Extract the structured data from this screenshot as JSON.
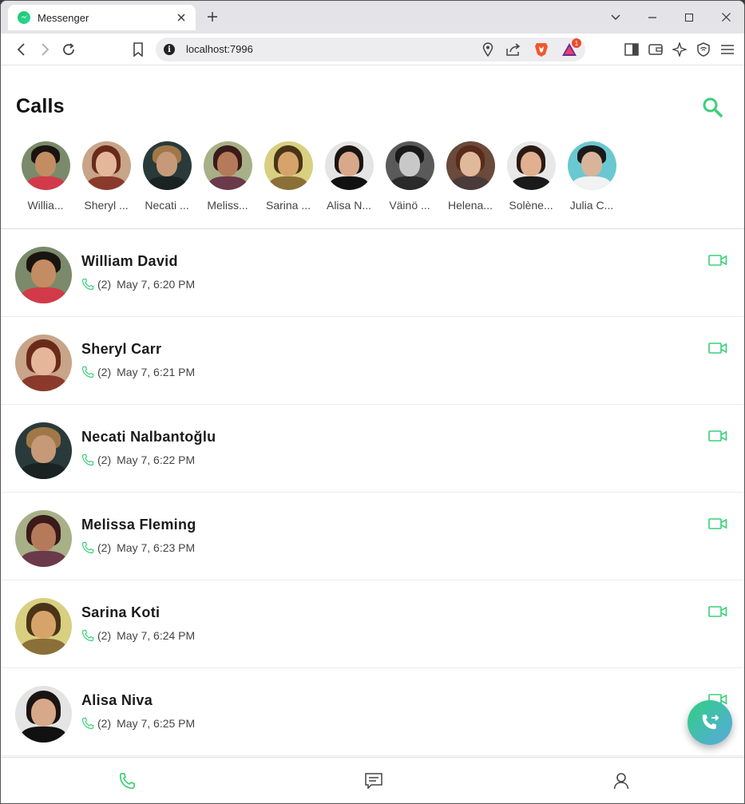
{
  "browser": {
    "tab_title": "Messenger",
    "url": "localhost:7996",
    "shields_badge": "1"
  },
  "app": {
    "title": "Calls",
    "accent_color": "#3ccf7a",
    "stories": [
      {
        "name": "Willia...",
        "avatar": "william-david-avatar"
      },
      {
        "name": "Sheryl ...",
        "avatar": "sheryl-carr-avatar"
      },
      {
        "name": "Necati ...",
        "avatar": "necati-avatar"
      },
      {
        "name": "Meliss...",
        "avatar": "melissa-avatar"
      },
      {
        "name": "Sarina ...",
        "avatar": "sarina-avatar"
      },
      {
        "name": "Alisa N...",
        "avatar": "alisa-avatar"
      },
      {
        "name": "Väinö ...",
        "avatar": "vaino-avatar"
      },
      {
        "name": "Helena...",
        "avatar": "helena-avatar"
      },
      {
        "name": "Solène...",
        "avatar": "solene-avatar"
      },
      {
        "name": "Julia C...",
        "avatar": "julia-avatar"
      }
    ],
    "calls": [
      {
        "name": "William David",
        "count": "(2)",
        "time": "May 7, 6:20 PM"
      },
      {
        "name": "Sheryl Carr",
        "count": "(2)",
        "time": "May 7, 6:21 PM"
      },
      {
        "name": "Necati Nalbantoğlu",
        "count": "(2)",
        "time": "May 7, 6:22 PM"
      },
      {
        "name": "Melissa Fleming",
        "count": "(2)",
        "time": "May 7, 6:23 PM"
      },
      {
        "name": "Sarina Koti",
        "count": "(2)",
        "time": "May 7, 6:24 PM"
      },
      {
        "name": "Alisa Niva",
        "count": "(2)",
        "time": "May 7, 6:25 PM"
      }
    ],
    "nav": [
      {
        "name": "calls",
        "icon": "phone-icon",
        "active": true
      },
      {
        "name": "chats",
        "icon": "chat-icon",
        "active": false
      },
      {
        "name": "profile",
        "icon": "user-icon",
        "active": false
      }
    ]
  }
}
